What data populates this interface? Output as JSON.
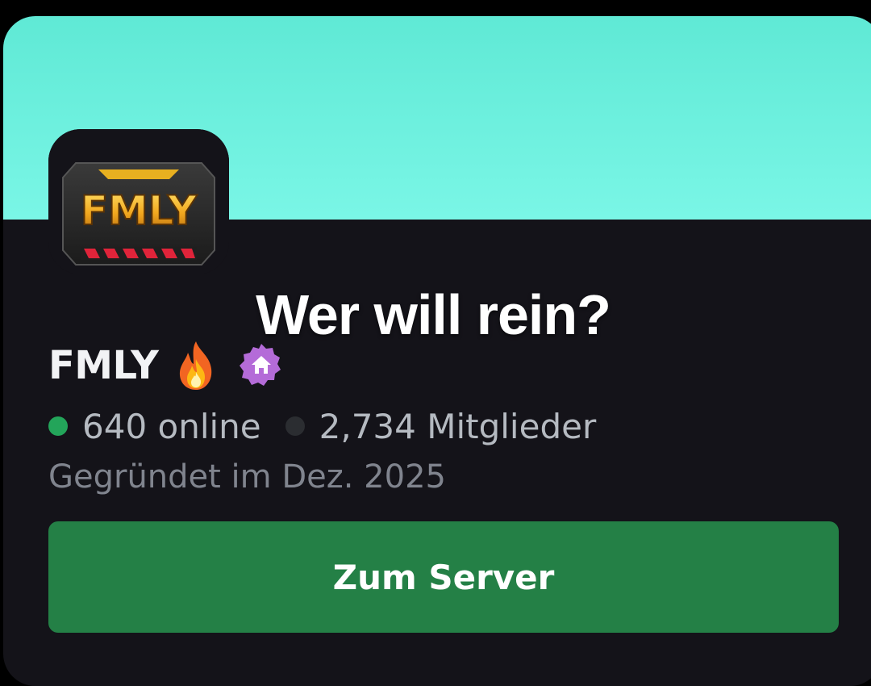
{
  "overlay": {
    "caption": "Wer will rein?"
  },
  "server": {
    "logo_text": "FMLY",
    "name": "FMLY",
    "emoji_icon": "fire-icon",
    "badge_icon": "home-badge-icon",
    "online_count": "640 online",
    "member_count": "2,734 Mitglieder",
    "founded": "Gegründet im Dez. 2025"
  },
  "actions": {
    "join_label": "Zum Server"
  },
  "colors": {
    "banner": "#6ef0df",
    "card_bg": "#141319",
    "online_dot": "#23a55a",
    "button": "#248046",
    "badge": "#b46bd8"
  }
}
